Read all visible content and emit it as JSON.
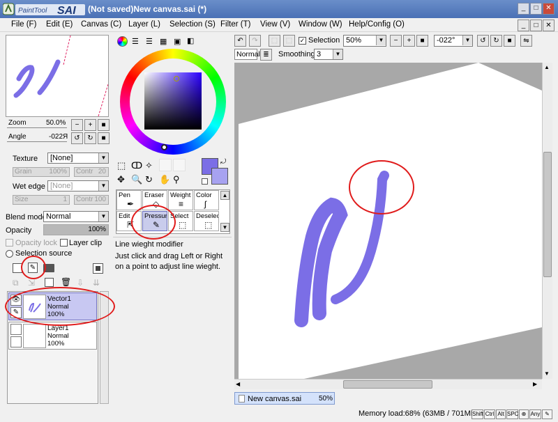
{
  "window": {
    "app_logo": "PaintTool SAI",
    "title": "(Not saved)New canvas.sai (*)",
    "min_label": "_",
    "max_label": "□",
    "close_label": "✕"
  },
  "menu": [
    "File (F)",
    "Edit (E)",
    "Canvas (C)",
    "Layer (L)",
    "Selection (S)",
    "Filter (T)",
    "View (V)",
    "Window (W)",
    "Help/Config (O)"
  ],
  "navigator": {
    "zoom_label": "Zoom",
    "zoom_value": "50.0%",
    "angle_label": "Angle",
    "angle_value": "-022Я"
  },
  "brush_panel": {
    "texture_label": "Texture",
    "texture_value": "[None]",
    "grain_label": "Grain",
    "grain_value": "100%",
    "contr_label": "Contr",
    "contr_value": "20",
    "wet_edge_label": "Wet edge",
    "wet_edge_value": "[None]",
    "size_label": "Size",
    "size_value": "1",
    "contr2_label": "Contr",
    "contr2_value": "100"
  },
  "layer_panel": {
    "blend_mode_label": "Blend mode",
    "blend_mode_value": "Normal",
    "opacity_label": "Opacity",
    "opacity_value": "100%",
    "opacity_fraction": 1.0,
    "opacity_lock_label": "Opacity lock",
    "layer_clip_label": "Layer clip",
    "selection_source_label": "Selection source",
    "layers": [
      {
        "name": "Vector1",
        "mode": "Normal",
        "opacity": "100%",
        "selected": true
      },
      {
        "name": "Layer1",
        "mode": "Normal",
        "opacity": "100%",
        "selected": false
      }
    ]
  },
  "color_panel": {
    "primary_color": "#7b6ee6",
    "secondary_color": "#a7a2f0"
  },
  "tools": {
    "row1": [
      "Pen",
      "Eraser",
      "Weight",
      "Color"
    ],
    "row2": [
      "Edit",
      "Pressure",
      "Select",
      "Deselect"
    ],
    "selected": "Pressure",
    "help_title": "Line wieght modifier",
    "help_text": "Just click and drag Left or Right on a point to adjust line wieght."
  },
  "canvas_toolbar": {
    "selection_label": "Selection",
    "zoom_value": "50%",
    "angle_value": "-022°",
    "mode_label": "Normal",
    "smoothing_label": "Smoothing",
    "smoothing_value": "3"
  },
  "document_tab": {
    "name": "New canvas.sai",
    "zoom": "50%"
  },
  "status": {
    "memory": "Memory load:68% (63MB / 701MB)",
    "keys": [
      "Shift",
      "Ctrl",
      "Alt",
      "SPC",
      "⊕",
      "Any",
      "✎"
    ]
  }
}
